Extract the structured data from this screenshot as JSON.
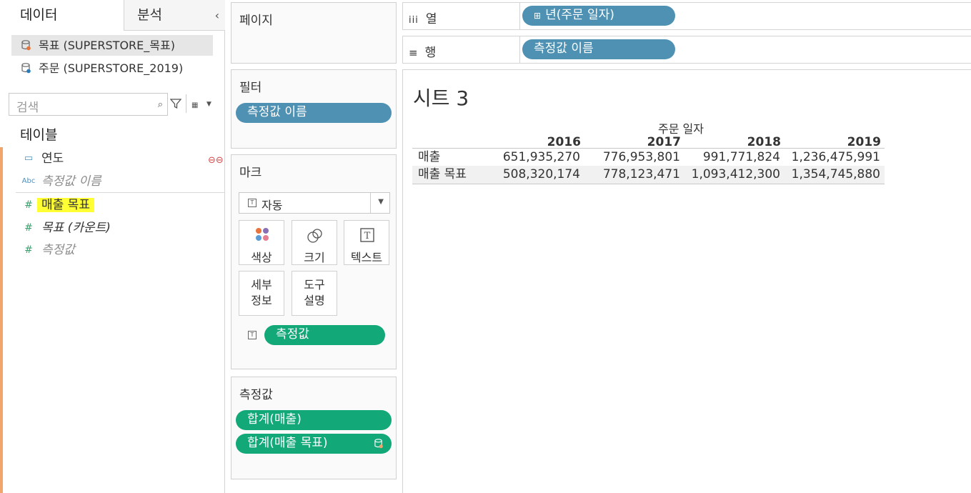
{
  "data_pane": {
    "tabs": {
      "data": "데이터",
      "analysis": "분석"
    },
    "collapse_glyph": "‹",
    "sources": [
      {
        "label": "목표 (SUPERSTORE_목표)",
        "selected": true
      },
      {
        "label": "주문 (SUPERSTORE_2019)",
        "selected": false
      }
    ],
    "search_placeholder": "검색",
    "tables_header": "테이블",
    "fields": [
      {
        "label": "연도",
        "type_icon": "calendar-icon",
        "italic": false
      },
      {
        "label": "측정값 이름",
        "type_icon": "Abc",
        "italic": true
      },
      {
        "label": "매출 목표",
        "type_icon": "#",
        "highlighted": true
      },
      {
        "label": "목표 (카운트)",
        "type_icon": "#",
        "italic": true
      },
      {
        "label": "측정값",
        "type_icon": "#",
        "italic": true
      }
    ]
  },
  "pages_card": {
    "title": "페이지"
  },
  "filters_card": {
    "title": "필터",
    "pills": [
      "측정값 이름"
    ]
  },
  "marks_card": {
    "title": "마크",
    "mark_type": "자동",
    "buttons": [
      {
        "label": "색상",
        "icon": "color-icon"
      },
      {
        "label": "크기",
        "icon": "size-icon"
      },
      {
        "label": "텍스트",
        "icon": "text-icon"
      },
      {
        "label_line1": "세부",
        "label_line2": "정보",
        "icon": "detail"
      },
      {
        "label_line1": "도구",
        "label_line2": "설명",
        "icon": "tooltip"
      }
    ],
    "pill": "측정값"
  },
  "measures_card": {
    "title": "측정값",
    "pills": [
      "합계(매출)",
      "합계(매출 목표)"
    ]
  },
  "columns_shelf": {
    "label": "열",
    "icon": "iii",
    "pill": "년(주문 일자)"
  },
  "rows_shelf": {
    "label": "행",
    "icon": "≡",
    "pill": "측정값 이름"
  },
  "view": {
    "sheet_title": "시트 3",
    "column_header": "주문 일자",
    "years": [
      "2016",
      "2017",
      "2018",
      "2019"
    ],
    "rows": [
      {
        "label": "매출",
        "values": [
          "651,935,270",
          "776,953,801",
          "991,771,824",
          "1,236,475,991"
        ]
      },
      {
        "label": "매출 목표",
        "values": [
          "508,320,174",
          "778,123,471",
          "1,093,412,300",
          "1,354,745,880"
        ]
      }
    ]
  },
  "colors": {
    "blue_pill": "#4f91b3",
    "green_pill": "#13a878",
    "highlight": "#ffff33",
    "accent_bar": "#f3a46b"
  }
}
